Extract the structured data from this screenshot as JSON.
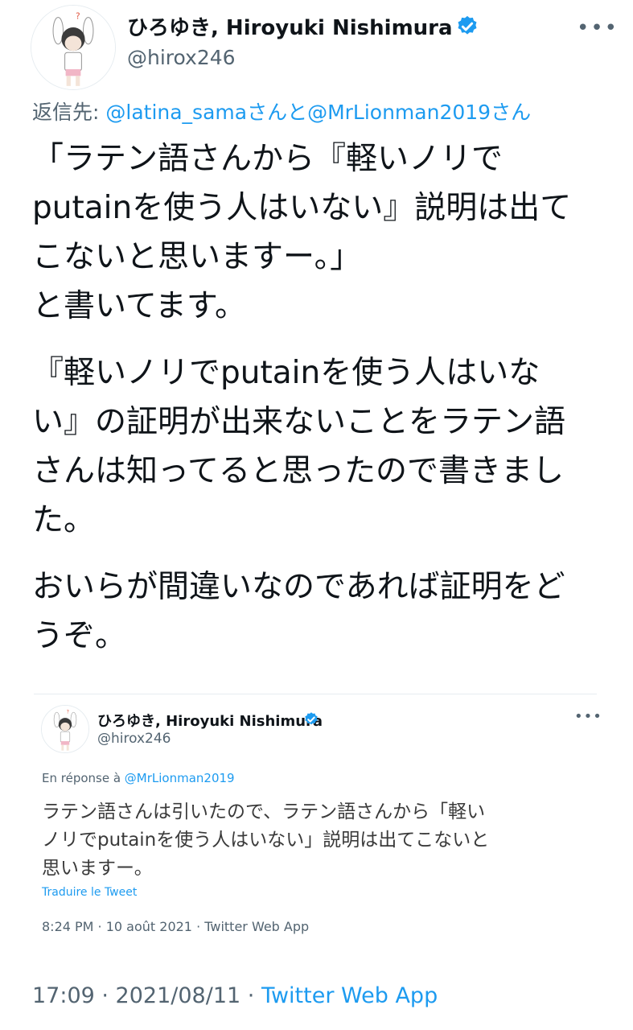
{
  "tweet": {
    "author_name": "ひろゆき, Hiroyuki Nishimura",
    "handle": "@hirox246",
    "more_icon": "•••",
    "reply_prefix": "返信先: ",
    "reply_mentions": "@latina_samaさんと@MrLionman2019さん",
    "paragraphs": [
      "「ラテン語さんから『軽いノリで\nputainを使う人はいない』説明は出て\nこないと思いますー。」\nと書いてます。",
      "『軽いノリでputainを使う人はいな\nい』の証明が出来ないことをラテン語\nさんは知ってると思ったので書きまし\nた。",
      "おいらが間違いなのであれば証明をど\nうぞ。"
    ],
    "time": "17:09 · 2021/08/11 · ",
    "app": "Twitter Web App"
  },
  "quoted": {
    "author_name": "ひろゆき, Hiroyuki Nishimura",
    "handle": "@hirox246",
    "more_icon": "•••",
    "reply_prefix": "En réponse à ",
    "reply_mention": "@MrLionman2019",
    "text": "ラテン語さんは引いたので、ラテン語さんから「軽い\nノリでputainを使う人はいない」説明は出てこないと\n思いますー。",
    "translate_label": "Traduire le Tweet",
    "meta": "8:24 PM · 10 août 2021 · Twitter Web App"
  },
  "colors": {
    "link": "#1d9bf0",
    "secondary_text": "#536471",
    "verified_badge": "#1d9bf0"
  }
}
